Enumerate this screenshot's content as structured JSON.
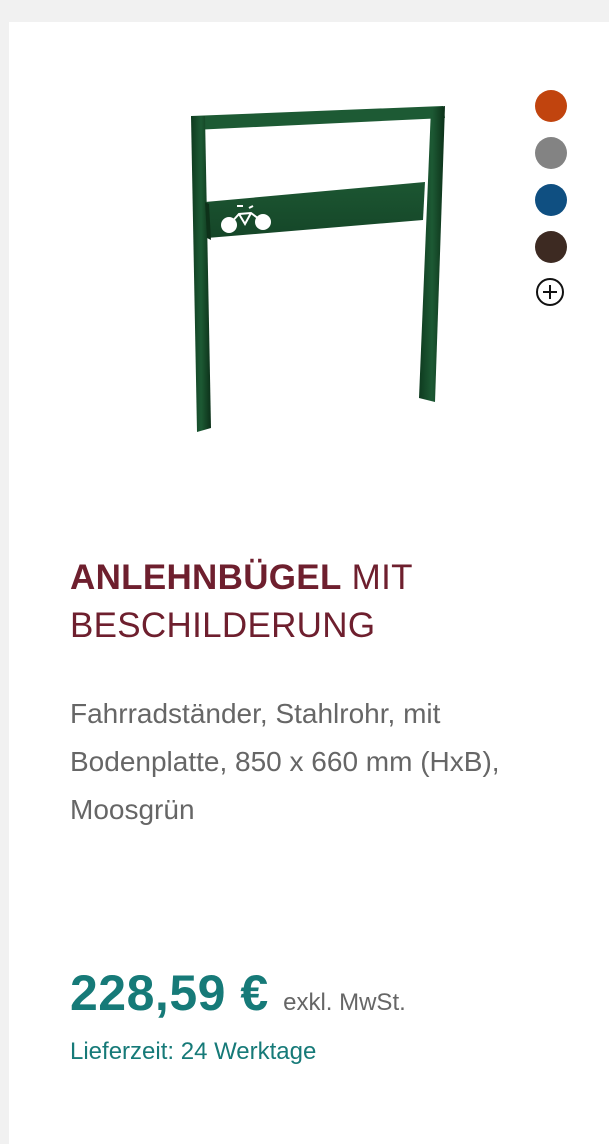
{
  "product": {
    "title_bold": "ANLEHNBÜGEL",
    "title_rest": " MIT BESCHILDERUNG",
    "description": "Fahrradständer, Stahlrohr, mit Bodenplatte, 850 x 660 mm (HxB), Moosgrün",
    "price": "228,59 €",
    "vat_note": "exkl. MwSt.",
    "delivery": "Lieferzeit: 24 Werktage",
    "image_color": "#17492a"
  },
  "color_swatches": [
    {
      "name": "orange",
      "color": "#c1440e"
    },
    {
      "name": "grey",
      "color": "#838383"
    },
    {
      "name": "blue",
      "color": "#0f4f81"
    },
    {
      "name": "brown",
      "color": "#3d2a22"
    }
  ],
  "more_colors_icon": "plus-circle-icon"
}
